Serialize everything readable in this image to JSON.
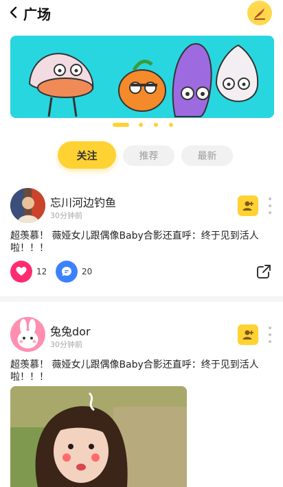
{
  "header": {
    "title": "广场",
    "back_icon": "chevron-left-icon",
    "compose_icon": "quill-pen-icon",
    "accent": "#ffd84d"
  },
  "banner": {
    "background": "#28d6df",
    "slide_count": 4,
    "active_slide": 1
  },
  "tabs": [
    {
      "label": "关注",
      "active": true
    },
    {
      "label": "推荐",
      "active": false
    },
    {
      "label": "最新",
      "active": false
    }
  ],
  "posts": [
    {
      "username": "忘川河边钓鱼",
      "time": "30分钟前",
      "content": "超羡慕！ 薇娅女儿跟偶像Baby合影还直呼：终于见到活人啦！！！",
      "likes": "12",
      "comments": "20"
    },
    {
      "username": "兔兔dor",
      "time": "30分钟前",
      "content": "超羡慕！ 薇娅女儿跟偶像Baby合影还直呼：终于见到活人啦！！！"
    }
  ],
  "colors": {
    "like": "#ff2d6f",
    "comment": "#3c82ff",
    "follow": "#ffd233"
  }
}
